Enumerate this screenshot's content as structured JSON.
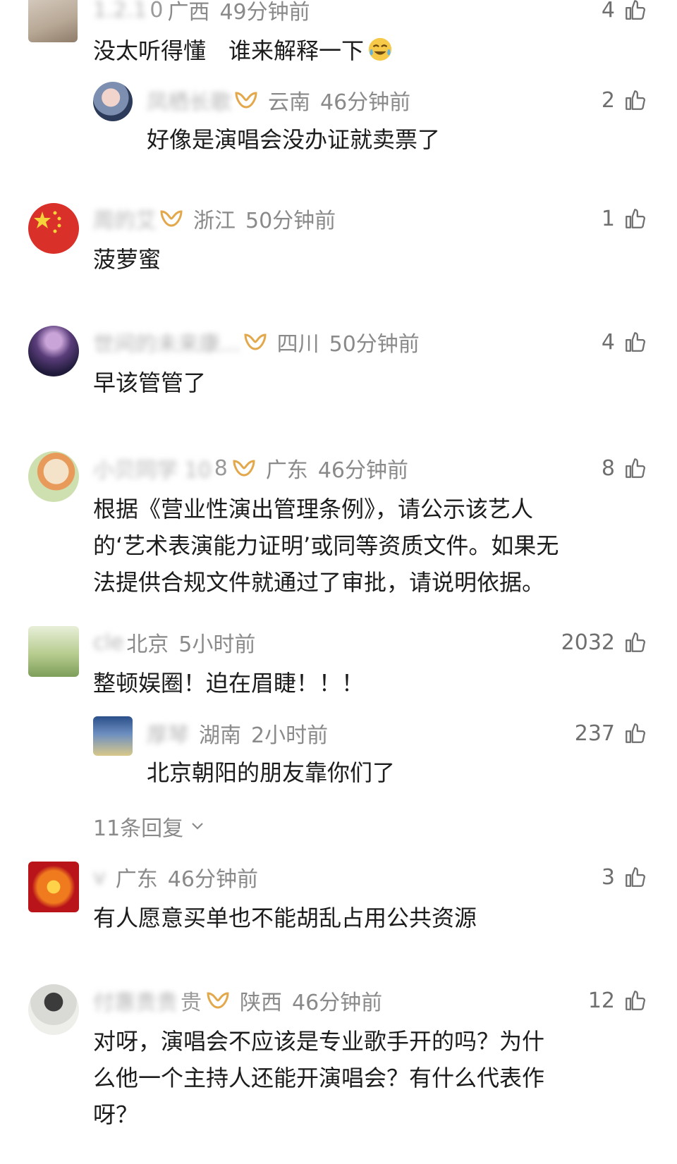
{
  "comments": [
    {
      "name_hidden": "1.2.1",
      "name_tail": "0",
      "location": "广西",
      "time": "49分钟前",
      "likes": "4",
      "text": "没太听得懂　谁来解释一下",
      "emoji": "tears-of-joy-emoji",
      "reply": {
        "name_hidden": "凤栖长歌",
        "vip": true,
        "location": "云南",
        "time": "46分钟前",
        "likes": "2",
        "text": "好像是演唱会没办证就卖票了"
      }
    },
    {
      "name_hidden": "周的艾",
      "vip": true,
      "location": "浙江",
      "time": "50分钟前",
      "likes": "1",
      "text": "菠萝蜜"
    },
    {
      "name_hidden": "世间的未来康...",
      "name_tail": "...",
      "vip": true,
      "location": "四川",
      "time": "50分钟前",
      "likes": "4",
      "text": "早该管管了"
    },
    {
      "name_hidden": "小贝同学 10",
      "name_tail": "8",
      "vip": true,
      "location": "广东",
      "time": "46分钟前",
      "likes": "8",
      "text_lines": [
        "根据《营业性演出管理条例》，请公示该艺人",
        "的‘艺术表演能力证明’或同等资质文件。如果无",
        "法提供合规文件就通过了审批，请说明依据。"
      ]
    },
    {
      "name_hidden": "cle",
      "location": "北京",
      "time": "5小时前",
      "likes": "2032",
      "text": "整顿娱圈！迫在眉睫！！！",
      "reply": {
        "name_hidden": "厚琴",
        "location": "湖南",
        "time": "2小时前",
        "likes": "237",
        "text": "北京朝阳的朋友靠你们了"
      },
      "more_replies": "11条回复"
    },
    {
      "name_hidden": "v",
      "location": "广东",
      "time": "46分钟前",
      "likes": "3",
      "text": "有人愿意买单也不能胡乱占用公共资源"
    },
    {
      "name_hidden": "付惠贵贵",
      "name_tail": "贵",
      "vip": true,
      "location": "陕西",
      "time": "46分钟前",
      "likes": "12",
      "text_lines": [
        "对呀，演唱会不应该是专业歌手开的吗？为什",
        "么他一个主持人还能开演唱会？有什么代表作",
        "呀？"
      ]
    }
  ],
  "colors": {
    "background": "#ffffff",
    "text": "#1c1c1c",
    "meta": "#8a8a8a",
    "vip_gold": "#e3a84b"
  }
}
